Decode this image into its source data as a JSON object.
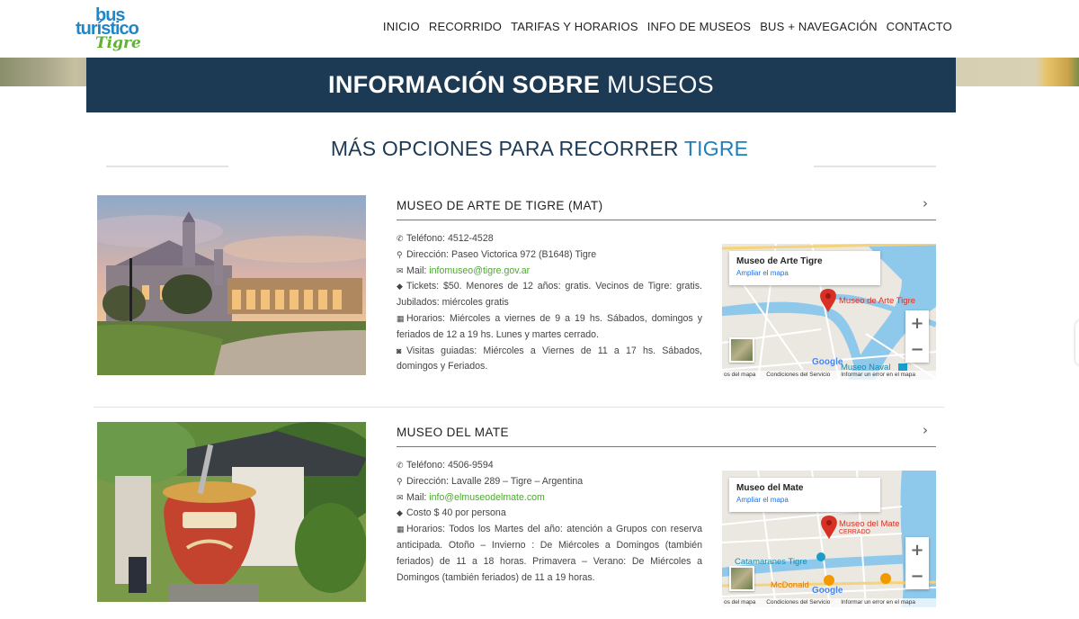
{
  "logo": {
    "line1": "bus",
    "line2": "turístico",
    "line3": "Tigre"
  },
  "nav": [
    "INICIO",
    "RECORRIDO",
    "TARIFAS Y HORARIOS",
    "INFO DE MUSEOS",
    "BUS + NAVEGACIÓN",
    "CONTACTO"
  ],
  "banner": {
    "bold": "INFORMACIÓN SOBRE",
    "light": "MUSEOS"
  },
  "subtitle": {
    "main": "MÁS OPCIONES PARA RECORRER",
    "accent": "TIGRE"
  },
  "museums": [
    {
      "title": "MUSEO DE ARTE DE TIGRE (MAT)",
      "phone": "Teléfono: 4512-4528",
      "address": "Dirección: Paseo Victorica 972 (B1648) Tigre",
      "mail_label": "Mail: ",
      "mail": "infomuseo@tigre.gov.ar",
      "tickets": "Tickets: $50. Menores de 12 años: gratis. Vecinos de Tigre: gratis. Jubilados: miércoles gratis",
      "hours": "Horarios: Miércoles a viernes de 9 a 19 hs. Sábados, domingos y feriados de 12 a 19 hs. Lunes y martes cerrado.",
      "tours": "Visitas guiadas: Miércoles a Viernes de 11 a 17 hs. Sábados, domingos y Feriados.",
      "map": {
        "card_title": "Museo de Arte Tigre",
        "card_link": "Ampliar el mapa",
        "pin_label": "Museo de Arte Tigre",
        "place": "Museo Naval",
        "footer": [
          "os del mapa",
          "Condiciones del Servicio",
          "Informar un error en el mapa"
        ]
      }
    },
    {
      "title": "MUSEO DEL MATE",
      "phone": "Teléfono: 4506-9594",
      "address": "Dirección: Lavalle 289 – Tigre – Argentina",
      "mail_label": "Mail: ",
      "mail": "info@elmuseodelmate.com",
      "cost": "Costo $ 40 por persona",
      "hours": "Horarios: Todos los Martes del año: atención a Grupos con reserva anticipada. Otoño – Invierno : De Miércoles a Domingos (también feriados) de 11 a 18 horas. Primavera – Verano: De Miércoles a Domingos (también feriados) de 11 a 19 horas.",
      "map": {
        "card_title": "Museo del Mate",
        "card_link": "Ampliar el mapa",
        "pin_label": "Museo del Mate",
        "pin_sub": "CERRADO",
        "place": "Catamaranes Tigre",
        "place2": "McDonald",
        "footer": [
          "os del mapa",
          "Condiciones del Servicio",
          "Informar un error en el mapa"
        ]
      }
    }
  ],
  "colors": {
    "navy": "#1d3a55",
    "accent_blue": "#1f7fb8",
    "link_green": "#4caa2f"
  }
}
